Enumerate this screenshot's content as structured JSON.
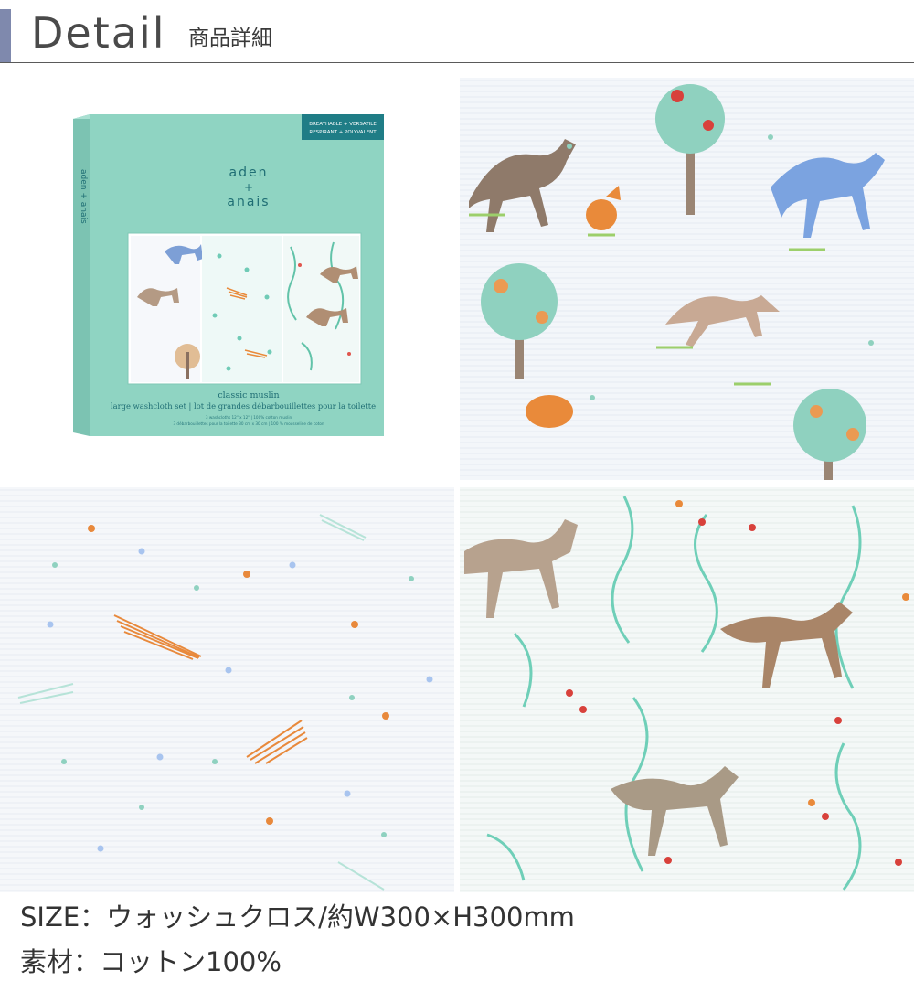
{
  "header": {
    "title": "Detail",
    "subtitle": "商品詳細"
  },
  "product": {
    "brand_top": "aden",
    "brand_plus": "+",
    "brand_bottom": "anais",
    "badge_line1": "BREATHABLE + VERSATILE",
    "badge_line2": "RESPIRANT + POLYVALENT",
    "line_name": "classic muslin",
    "product_name": "large washcloth set | lot de grandes débarbouillettes pour la toilette",
    "small_line1": "3 washcloths 12\" x 12\" | 100% cotton muslin",
    "small_line2": "3 débarbouillettes pour la toilette 30 cm x 30 cm | 100 % mousseline de coton"
  },
  "specs": {
    "size": "SIZE：ウォッシュクロス/約W300×H300mm",
    "material": "素材：コットン100%"
  },
  "colors": {
    "accent_bar": "#7f89ad",
    "box_mint": "#8fd4c2",
    "badge_teal": "#1f7d86"
  }
}
